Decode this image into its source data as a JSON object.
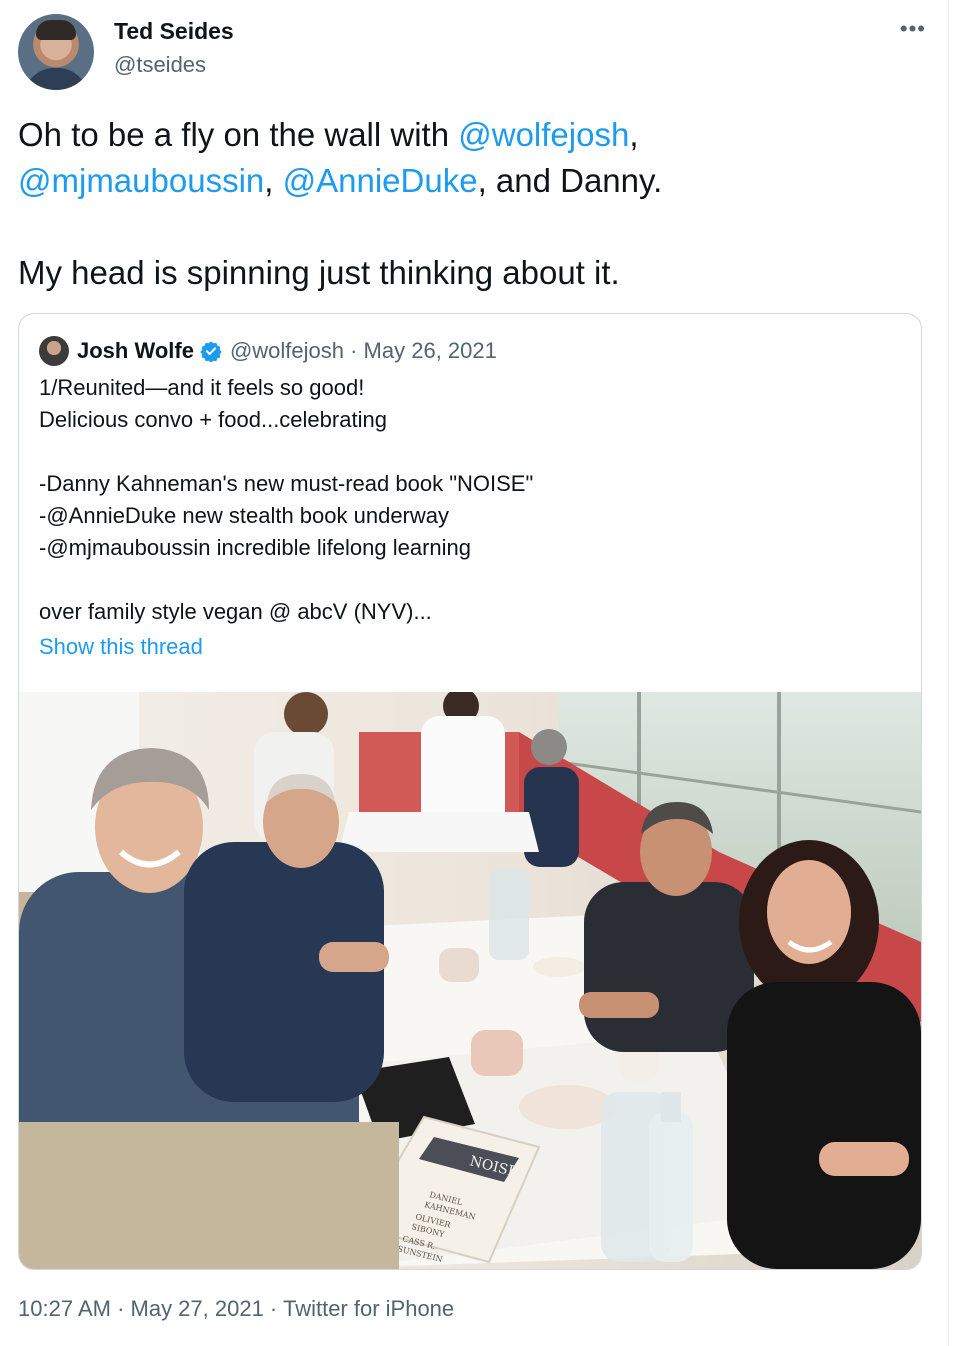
{
  "author": {
    "name": "Ted Seides",
    "handle": "@tseides"
  },
  "more_label": "•••",
  "tweet": {
    "line1_pre": "Oh to be a fly on the wall with ",
    "mention1": "@wolfejosh",
    "line1_post": ",",
    "mention2": "@mjmauboussin",
    "sep": ", ",
    "mention3": "@AnnieDuke",
    "line2_post": ", and Danny.",
    "line3": "My head is spinning just thinking about it."
  },
  "quote": {
    "name": "Josh Wolfe",
    "meta": "@wolfejosh · May 26, 2021",
    "lines": [
      "1/Reunited—and it feels so good!",
      "Delicious convo + food...celebrating",
      "",
      "-Danny Kahneman's new must-read book \"NOISE\"",
      "-@AnnieDuke new stealth book underway",
      "-@mjmauboussin incredible lifelong learning",
      "",
      "over family style vegan @ abcV (NYV)..."
    ],
    "show_thread": "Show this thread"
  },
  "book": {
    "title": "NOISE",
    "authors": [
      "DANIEL",
      "KAHNEMAN",
      "OLIVIER",
      "SIBONY",
      "CASS R.",
      "SUNSTEIN"
    ]
  },
  "timestamp": "10:27 AM · May 27, 2021 · Twitter for iPhone",
  "colors": {
    "link": "#1d9bf0",
    "secondary": "#536471",
    "border": "#cfd9de"
  }
}
